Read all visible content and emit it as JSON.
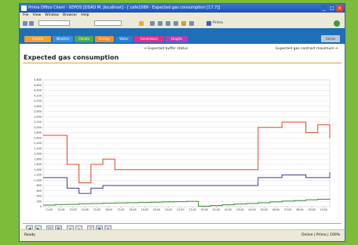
{
  "window": {
    "title": "Prima Office Client - XEPOS [DSAD M. jlocalhost] - [ cafe1089 - Expected gas consumption [17.7]]",
    "menu": [
      "File",
      "View",
      "Window",
      "Browser",
      "Help"
    ],
    "product_name": "Prima"
  },
  "tabs": [
    {
      "label": "Control",
      "color": "#f0a030"
    },
    {
      "label": "Weather",
      "color": "#3c8fd8"
    },
    {
      "label": "Clients",
      "color": "#50a84c"
    },
    {
      "label": "Energy",
      "color": "#f08c28"
    },
    {
      "label": "Water",
      "color": "#2a7fd0"
    },
    {
      "label": "Generators",
      "color": "#d8308c"
    },
    {
      "label": "Graphs",
      "color": "#b040b0"
    }
  ],
  "close_button": "Cerrar",
  "legend": {
    "buffer_status": "Expected buffer status",
    "contract_maximum": "Expected gas contract maximum"
  },
  "page": {
    "title": "Expected gas consumption"
  },
  "chart_data": {
    "type": "line",
    "ylim": [
      0,
      4800
    ],
    "y_ticks": [
      "0",
      "200",
      "400",
      "600",
      "800",
      "1,000",
      "1,200",
      "1,400",
      "1,600",
      "1,800",
      "2,000",
      "2,200",
      "2,400",
      "2,600",
      "2,800",
      "3,000",
      "3,200",
      "3,400",
      "3,600",
      "3,800",
      "4,000",
      "4,200",
      "4,400",
      "4,600",
      "4,800"
    ],
    "x_labels": [
      "11:00",
      "12:00",
      "13:00",
      "14:00",
      "15:00",
      "16:00",
      "17:00",
      "18:00",
      "19:00",
      "20:00",
      "21:00",
      "22:00",
      "23:00",
      "00:00",
      "01:00",
      "02:00",
      "03:00",
      "04:00",
      "05:00",
      "06:00",
      "07:00",
      "08:00",
      "09:00",
      "10:00"
    ],
    "series": [
      {
        "color": "#e0421c",
        "values": [
          2700,
          2700,
          1600,
          900,
          1600,
          1800,
          1400,
          1400,
          1400,
          1400,
          1400,
          1400,
          1400,
          1400,
          1400,
          1400,
          1400,
          1400,
          3000,
          3000,
          3200,
          3200,
          2800,
          3100,
          2600
        ]
      },
      {
        "color": "#3c3c8c",
        "values": [
          1100,
          1100,
          700,
          500,
          700,
          800,
          800,
          800,
          800,
          800,
          800,
          800,
          800,
          800,
          800,
          800,
          800,
          800,
          1100,
          1100,
          1200,
          1200,
          1100,
          1100,
          1300
        ]
      },
      {
        "color": "#2e8a2e",
        "values": [
          60,
          80,
          90,
          110,
          120,
          130,
          140,
          150,
          160,
          170,
          180,
          190,
          200,
          20,
          40,
          70,
          100,
          120,
          150,
          180,
          210,
          230,
          260,
          280,
          300
        ]
      }
    ]
  },
  "status": {
    "left": "Ready",
    "right": "Online | Prima | 100%"
  }
}
